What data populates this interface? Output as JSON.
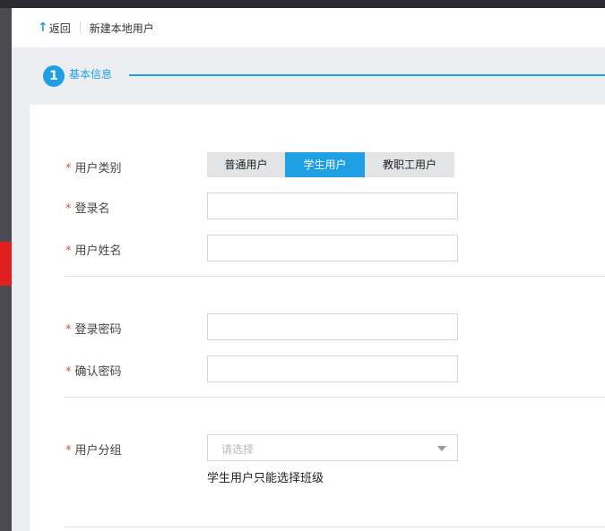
{
  "header": {
    "back_label": "返回",
    "title": "新建本地用户"
  },
  "steps": {
    "number": "1",
    "label": "基本信息"
  },
  "form": {
    "required_mark": "*",
    "user_type": {
      "label": "用户类别",
      "options": [
        "普通用户",
        "学生用户",
        "教职工用户"
      ],
      "selected": "学生用户"
    },
    "login_name": {
      "label": "登录名",
      "value": ""
    },
    "real_name": {
      "label": "用户姓名",
      "value": ""
    },
    "password": {
      "label": "登录密码",
      "value": ""
    },
    "confirm_password": {
      "label": "确认密码",
      "value": ""
    },
    "user_group": {
      "label": "用户分组",
      "placeholder": "请选择",
      "hint": "学生用户只能选择班级"
    }
  },
  "colors": {
    "accent": "#1fa0e4",
    "required": "#d9534f",
    "sidebar_highlight": "#e02020"
  },
  "icons": {
    "back": "up-arrow-icon",
    "dropdown": "caret-down-icon"
  }
}
